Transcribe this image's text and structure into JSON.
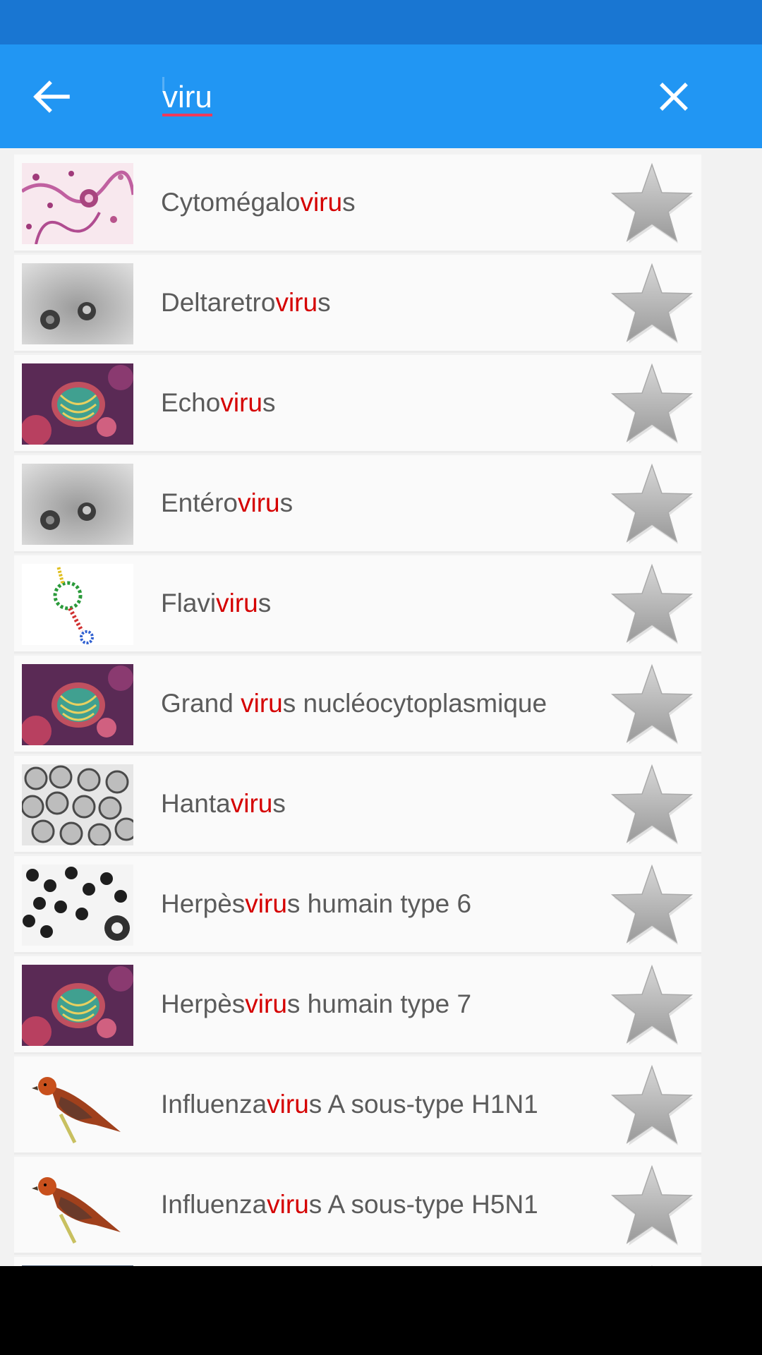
{
  "search": {
    "query": "viru"
  },
  "icons": {
    "back": "arrow-back-icon",
    "clear": "close-icon",
    "favorite": "star-outline-icon"
  },
  "colors": {
    "status_bar": "#1976d2",
    "app_bar": "#2196f3",
    "highlight": "#d50000",
    "text": "#5b5b5b",
    "search_underline": "#ef3b5b"
  },
  "results": [
    {
      "pre": "Cytomégalo",
      "match": "viru",
      "post": "s",
      "thumb": "histology"
    },
    {
      "pre": "Deltaretro",
      "match": "viru",
      "post": "s",
      "thumb": "em-gray"
    },
    {
      "pre": "Echo",
      "match": "viru",
      "post": "s",
      "thumb": "virus-art"
    },
    {
      "pre": "Entéro",
      "match": "viru",
      "post": "s",
      "thumb": "em-gray"
    },
    {
      "pre": "Flavi",
      "match": "viru",
      "post": "s",
      "thumb": "rna"
    },
    {
      "pre": "Grand ",
      "match": "viru",
      "post": "s nucléocytoplasmique",
      "thumb": "virus-art"
    },
    {
      "pre": "Hanta",
      "match": "viru",
      "post": "s",
      "thumb": "em-circles"
    },
    {
      "pre": "Herpès",
      "match": "viru",
      "post": "s humain type 6",
      "thumb": "em-dark"
    },
    {
      "pre": "Herpès",
      "match": "viru",
      "post": "s humain type 7",
      "thumb": "virus-art"
    },
    {
      "pre": "Influenza",
      "match": "viru",
      "post": "s A sous-type H1N1",
      "thumb": "bird"
    },
    {
      "pre": "Influenza",
      "match": "viru",
      "post": "s A sous-type H5N1",
      "thumb": "bird"
    },
    {
      "pre": "",
      "match": "",
      "post": "",
      "thumb": "partial"
    }
  ]
}
